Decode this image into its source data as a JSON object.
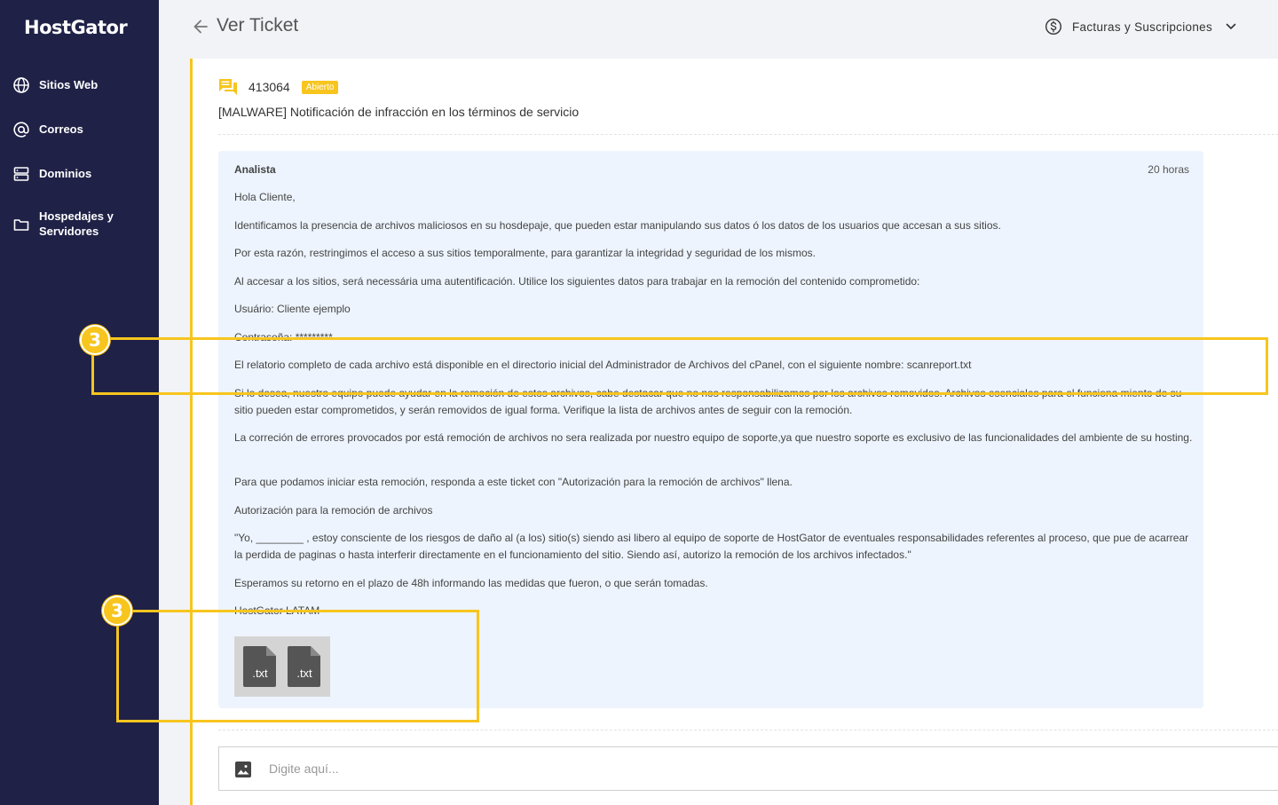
{
  "app": {
    "logo": "HostGator"
  },
  "sidebar": {
    "items": [
      {
        "label": "Sitios Web",
        "icon": "globe-icon"
      },
      {
        "label": "Correos",
        "icon": "at-icon"
      },
      {
        "label": "Dominios",
        "icon": "server-icon"
      },
      {
        "label": "Hospedajes y Servidores",
        "icon": "folder-icon"
      }
    ]
  },
  "header": {
    "title": "Ver Ticket",
    "billing_label": "Facturas y Suscripciones"
  },
  "ticket": {
    "id": "413064",
    "status": "Abierto",
    "subject": "[MALWARE] Notificación de infracción en los términos de servicio"
  },
  "message": {
    "author": "Analista",
    "time": "20 horas",
    "paragraphs": [
      "Hola Cliente,",
      "Identificamos la presencia de archivos maliciosos en su hosdepaje, que pueden estar manipulando sus datos ó los datos de los usuarios que accesan a sus sitios.",
      "Por esta razón, restringimos el acceso a sus sitios temporalmente, para garantizar la integridad y seguridad de los mismos.",
      "Al accesar a los sitios, será necessária uma autentificación. Utilice los siguientes datos para trabajar en la remoción del contenido comprometido:",
      "Usuário: Cliente ejemplo",
      "Contraseña: *********",
      "El relatorio completo de cada archivo está disponible en el directorio inicial del Administrador de Archivos del cPanel, con el siguiente nombre: scanreport.txt",
      "Si lo desea, nuestro equipo puede ayudar en la remoción de estos archivos, cabe destacar que no nos responsabilizamos por los archivos removidos. Archivos esenciales para el funciona miento de su sitio pueden estar comprometidos, y serán removidos de igual forma. Verifique la lista de archivos antes de seguir con la remoción.",
      "La correción de errores provocados por está remoción de archivos no sera realizada por nuestro equipo de soporte,ya que nuestro soporte es exclusivo de las funcionalidades del ambiente de su hosting.",
      "Para que podamos iniciar esta remoción, responda a este ticket con \"Autorización para la remoción de archivos\" llena.",
      "Autorización para la remoción de archivos",
      "\"Yo, ________ , estoy consciente de los riesgos de daño al (a los) sitio(s) siendo asi libero al equipo de soporte de HostGator de eventuales responsabilidades referentes al proceso, que pue de acarrear la perdida de paginas o hasta interferir directamente en el funcionamiento del sitio. Siendo así, autorizo la remoción de los archivos infectados.\"",
      "Esperamos su retorno en el plazo de 48h informando las medidas que fueron, o que serán tomadas.",
      "HostGator LATAM"
    ],
    "attachments": [
      ".txt",
      ".txt"
    ]
  },
  "reply": {
    "placeholder": "Digite aquí..."
  },
  "annotations": {
    "marker_1": "3",
    "marker_2": "3"
  },
  "colors": {
    "sidebar_bg": "#1f2147",
    "accent": "#f7c51e",
    "message_bg": "#edf4fd"
  }
}
